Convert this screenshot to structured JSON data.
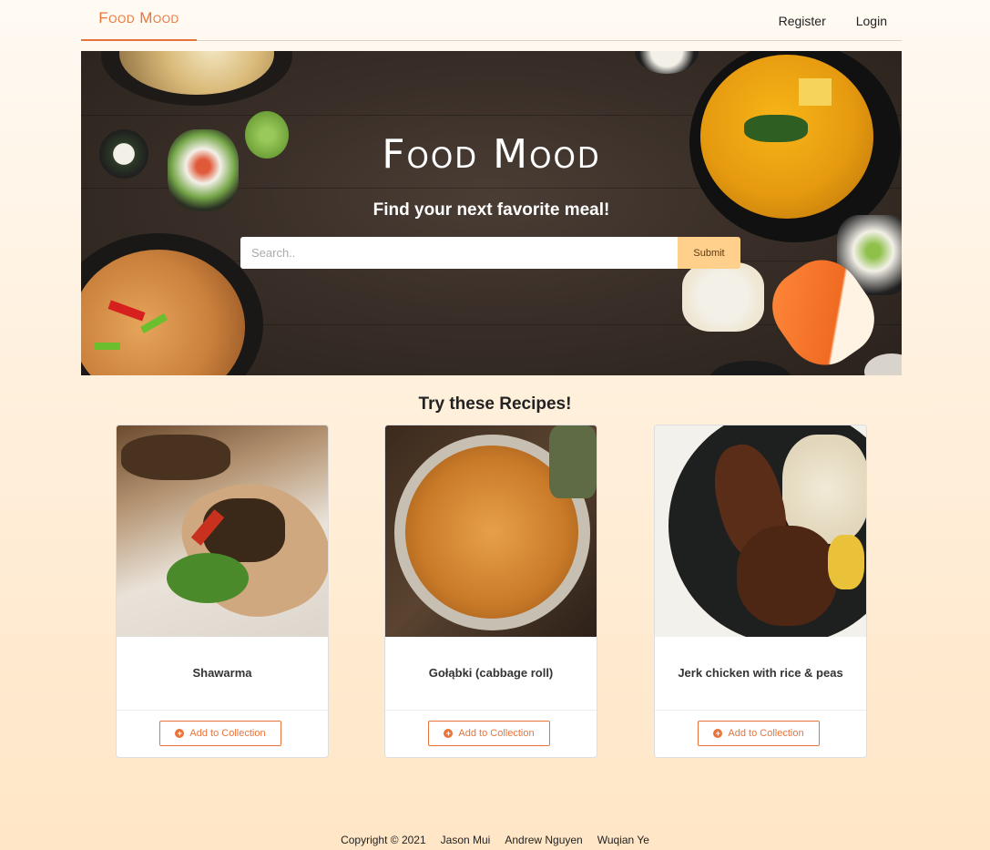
{
  "nav": {
    "brand": "Food Mood",
    "links": [
      "Register",
      "Login"
    ]
  },
  "hero": {
    "title": "Food Mood",
    "subtitle": "Find your next favorite meal!",
    "search_placeholder": "Search..",
    "submit_label": "Submit"
  },
  "recipes": {
    "title": "Try these Recipes!",
    "cards": [
      {
        "name": "Shawarma",
        "button": "Add to Collection",
        "icon": "plus-circle-icon"
      },
      {
        "name": "Gołąbki (cabbage roll)",
        "button": "Add to Collection",
        "icon": "plus-circle-icon"
      },
      {
        "name": "Jerk chicken with rice & peas",
        "button": "Add to Collection",
        "icon": "plus-circle-icon"
      }
    ]
  },
  "footer": {
    "copyright": "Copyright © 2021",
    "authors": [
      "Jason Mui",
      "Andrew Nguyen",
      "Wuqian Ye"
    ]
  },
  "colors": {
    "accent": "#e8743b",
    "submit_bg": "#ffcf8c"
  }
}
